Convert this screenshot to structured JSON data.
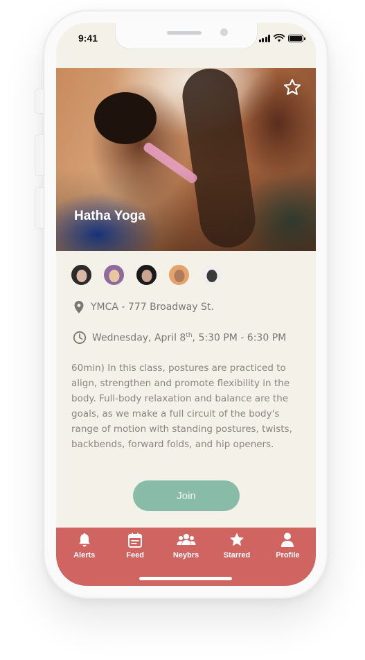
{
  "status_bar": {
    "time": "9:41"
  },
  "event": {
    "title": "Hatha Yoga",
    "location": "YMCA - 777 Broadway St.",
    "date_prefix": "Wednesday, April 8",
    "date_suffix": "th",
    "time_range": ", 5:30 PM - 6:30 PM",
    "description": "60min) In this class, postures are practiced to align, strengthen and promote flexibility in the body. Full-body relaxation and balance are the goals, as we make a full circuit of the body's range of motion with standing postures, twists, backbends, forward folds, and hip openers.",
    "join_label": "Join"
  },
  "attendees": [
    {
      "bg": "#2b2b2b",
      "face": "#d9b9a6"
    },
    {
      "bg": "#8f6a9e",
      "face": "#e8c7a0"
    },
    {
      "bg": "#1a1a1a",
      "face": "#c9a48e"
    },
    {
      "bg": "#e2a46a",
      "face": "#b07a5c"
    },
    {
      "bg": "#efefef",
      "face": "#3a3a3a"
    }
  ],
  "tabs": [
    {
      "label": "Alerts",
      "icon": "bell-icon"
    },
    {
      "label": "Feed",
      "icon": "calendar-icon"
    },
    {
      "label": "Neybrs",
      "icon": "group-icon"
    },
    {
      "label": "Starred",
      "icon": "star-icon"
    },
    {
      "label": "Profile",
      "icon": "person-icon"
    }
  ],
  "colors": {
    "background": "#f4f1e9",
    "accent_teal": "#88bba8",
    "tab_bar": "#d06461",
    "text_muted": "#7a7670"
  }
}
